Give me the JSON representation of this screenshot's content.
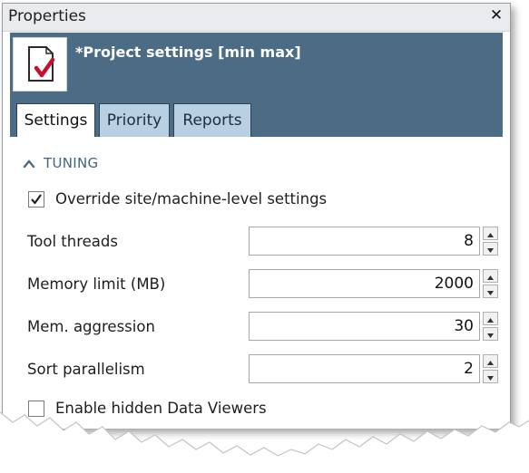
{
  "panel": {
    "title": "Properties",
    "close_glyph": "✕"
  },
  "header": {
    "icon": "document-check-icon",
    "title": "*Project settings [min max]",
    "tabs": [
      {
        "label": "Settings",
        "active": true
      },
      {
        "label": "Priority",
        "active": false
      },
      {
        "label": "Reports",
        "active": false
      }
    ]
  },
  "section": {
    "label": "TUNING",
    "expanded": true
  },
  "override": {
    "label": "Override site/machine-level settings",
    "checked": true
  },
  "fields": [
    {
      "label": "Tool threads",
      "value": "8"
    },
    {
      "label": "Memory limit (MB)",
      "value": "2000"
    },
    {
      "label": "Mem. aggression",
      "value": "30"
    },
    {
      "label": "Sort parallelism",
      "value": "2"
    }
  ],
  "hidden_viewers": {
    "label": "Enable hidden Data Viewers",
    "checked": false
  },
  "colors": {
    "header_bg": "#4c6b84",
    "tab_bg": "#b9cfe2",
    "section_text": "#3e6585",
    "check_red": "#c8102e"
  }
}
